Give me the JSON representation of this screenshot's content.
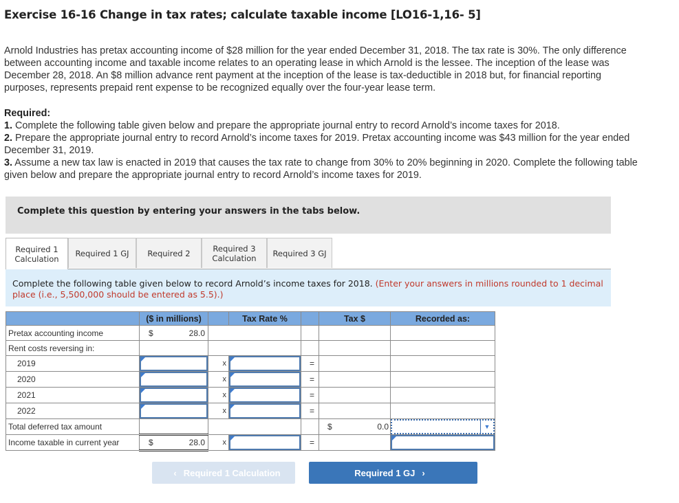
{
  "header": {
    "title": "Exercise 16-16 Change in tax rates; calculate taxable income [LO16-1,16- 5]"
  },
  "intro": "Arnold Industries has pretax accounting income of $28 million for the year ended December 31, 2018. The tax rate is 30%. The only difference between accounting income and taxable income relates to an operating lease in which Arnold is the lessee. The inception of the lease was December 28, 2018. An $8 million advance rent payment at the inception of the lease is tax-deductible in 2018 but, for financial reporting purposes, represents prepaid rent expense to be recognized equally over the four-year lease term.",
  "required": {
    "heading": "Required:",
    "items": [
      {
        "num": "1.",
        "text": " Complete the following table given below and prepare the appropriate journal entry to record Arnold’s income taxes for 2018."
      },
      {
        "num": "2.",
        "text": " Prepare the appropriate journal entry to record Arnold’s income taxes for 2019. Pretax accounting income was $43 million for the year ended December 31, 2019."
      },
      {
        "num": "3.",
        "text": " Assume a new tax law is enacted in 2019 that causes the tax rate to change from 30% to 20% beginning in 2020. Complete the following table given below and prepare the appropriate journal entry to record Arnold’s income taxes for 2019."
      }
    ]
  },
  "banner": "Complete this question by entering your answers in the tabs below.",
  "tabs": [
    {
      "label": "Required 1 Calculation",
      "active": true
    },
    {
      "label": "Required 1 GJ",
      "active": false
    },
    {
      "label": "Required 2",
      "active": false
    },
    {
      "label": "Required 3 Calculation",
      "active": false
    },
    {
      "label": "Required 3 GJ",
      "active": false
    }
  ],
  "instructions": {
    "main": "Complete the following table given below to record Arnold’s income taxes for 2018. ",
    "note": "(Enter your answers in millions rounded to 1 decimal place (i.e., 5,500,000 should be entered as 5.5).)"
  },
  "table": {
    "headers": {
      "label": "",
      "amount": "($ in millions)",
      "x": "",
      "rate": "Tax Rate %",
      "eq": "",
      "tax": "Tax $",
      "recorded": "Recorded as:"
    },
    "currency": "$",
    "times": "x",
    "equals": "=",
    "rows": {
      "pretax": {
        "label": "Pretax accounting income",
        "amount": "28.0"
      },
      "rent_heading": {
        "label": "Rent costs reversing in:"
      },
      "years": [
        {
          "label": "2019",
          "amount": "",
          "rate": "",
          "tax": ""
        },
        {
          "label": "2020",
          "amount": "",
          "rate": "",
          "tax": ""
        },
        {
          "label": "2021",
          "amount": "",
          "rate": "",
          "tax": ""
        },
        {
          "label": "2022",
          "amount": "",
          "rate": "",
          "tax": ""
        }
      ],
      "total": {
        "label": "Total deferred tax amount",
        "tax": "0.0",
        "recorded": ""
      },
      "taxable": {
        "label": "Income taxable in current year",
        "amount": "28.0",
        "rate": "",
        "recorded": ""
      }
    }
  },
  "nav": {
    "prev_label": "Required 1 Calculation",
    "next_label": "Required 1 GJ",
    "prev_icon": "‹",
    "next_icon": "›"
  }
}
